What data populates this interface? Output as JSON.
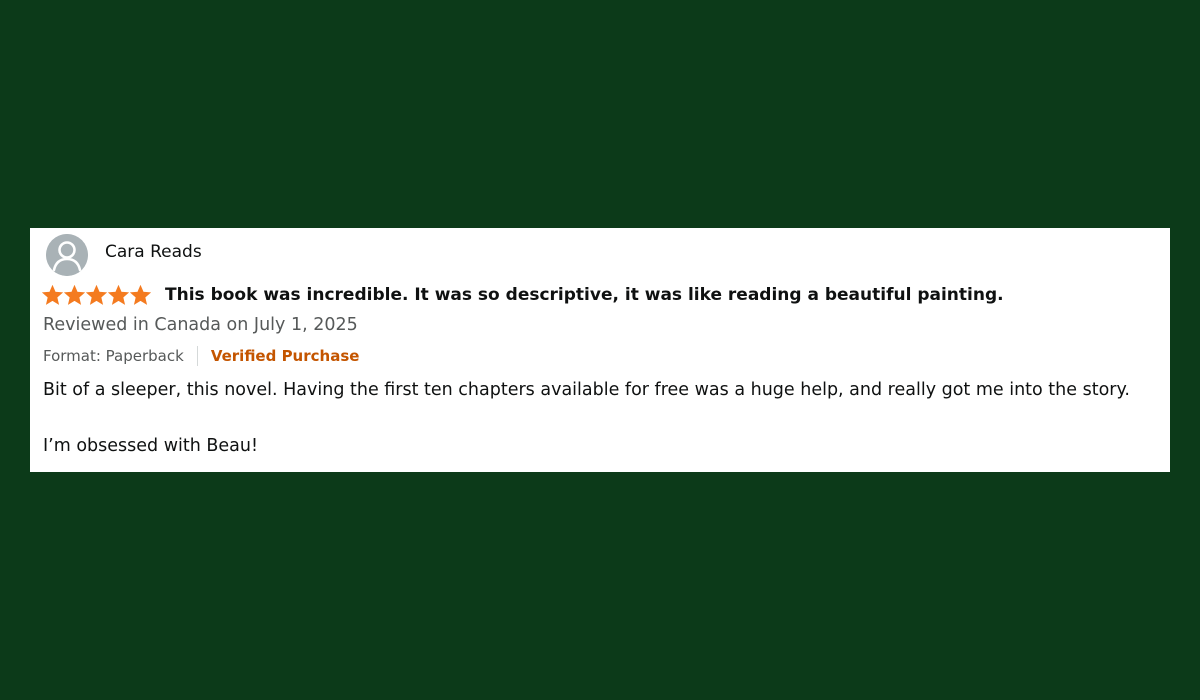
{
  "review": {
    "reviewer_name": "Cara Reads",
    "rating": 5,
    "max_rating": 5,
    "star_color": "#f47b20",
    "title": "This book was incredible. It was so descriptive, it was like reading a beautiful painting.",
    "meta": "Reviewed in Canada on July 1, 2025",
    "format": "Format: Paperback",
    "verified": "Verified Purchase",
    "verified_color": "#c45500",
    "body": [
      "Bit of a sleeper, this novel. Having the first ten chapters available for free was a huge help, and really got me into the story.",
      "I’m obsessed with Beau!"
    ]
  },
  "background_color": "#0c3a19",
  "avatar_icon": "user-silhouette-icon"
}
